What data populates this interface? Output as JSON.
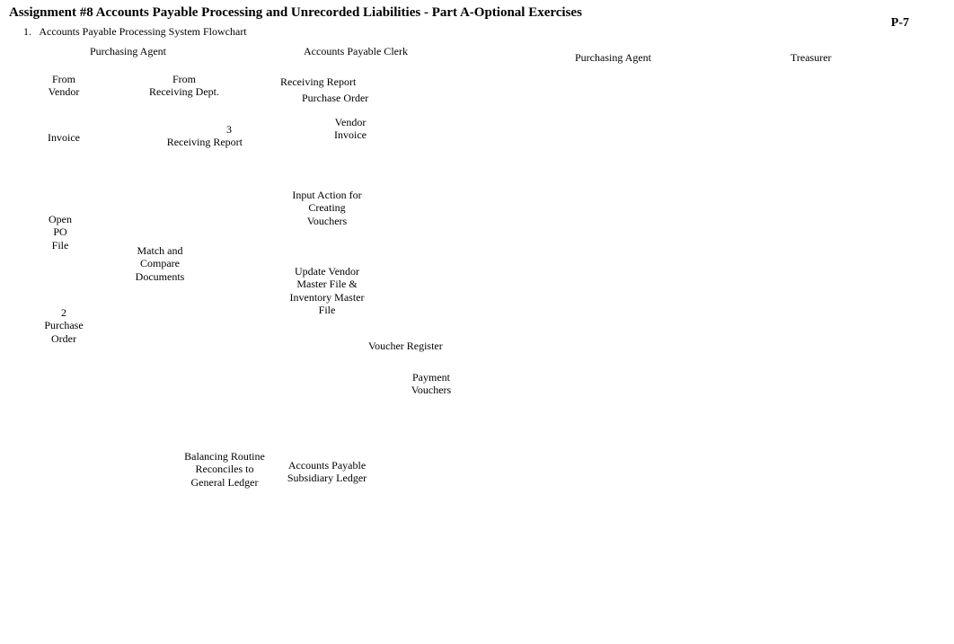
{
  "header": {
    "title": "Assignment #8 Accounts Payable Processing  and Unrecorded Liabilities - Part A-Optional Exercises",
    "page_number": "P-7",
    "subtitle_index": "1.",
    "subtitle_text": "Accounts Payable Processing System Flowchart"
  },
  "columns": {
    "purchasing_agent_left": "Purchasing Agent",
    "ap_clerk": "Accounts Payable Clerk",
    "purchasing_agent_right": "Purchasing Agent",
    "treasurer": "Treasurer"
  },
  "nodes": {
    "from_vendor_l1": "From",
    "from_vendor_l2": "Vendor",
    "from_recv_l1": "From",
    "from_recv_l2": "Receiving Dept.",
    "invoice": "Invoice",
    "recv_report_num": "3",
    "recv_report": "Receiving Report",
    "ap_recv_report": "Receiving Report",
    "ap_po": "Purchase Order",
    "vendor_l1": "Vendor",
    "vendor_l2": "Invoice",
    "open_po_l1": "Open",
    "open_po_l2": "PO",
    "open_po_l3": "File",
    "match_l1": "Match and",
    "match_l2": "Compare",
    "match_l3": "Documents",
    "po_num": "2",
    "po_l1": "Purchase",
    "po_l2": "Order",
    "input_act_l1": "Input Action for",
    "input_act_l2": "Creating",
    "input_act_l3": "Vouchers",
    "update_l1": "Update Vendor",
    "update_l2": "Master File &",
    "update_l3": "Inventory Master",
    "update_l4": "File",
    "voucher_register": "Voucher Register",
    "payment_l1": "Payment",
    "payment_l2": "Vouchers",
    "balancing_l1": "Balancing Routine",
    "balancing_l2": "Reconciles to",
    "balancing_l3": "General Ledger",
    "ap_ledger_l1": "Accounts Payable",
    "ap_ledger_l2": "Subsidiary Ledger"
  }
}
